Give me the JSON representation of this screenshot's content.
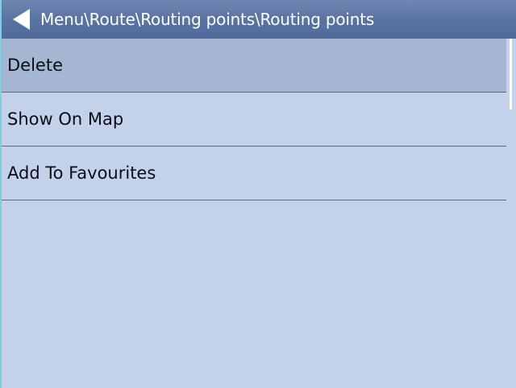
{
  "header": {
    "path": "Menu\\Route\\Routing points\\Routing points",
    "back_icon": "back-arrow-icon"
  },
  "menu": {
    "items": [
      {
        "label": "Delete",
        "selected": true
      },
      {
        "label": "Show On Map",
        "selected": false
      },
      {
        "label": "Add To Favourites",
        "selected": false
      }
    ]
  },
  "colors": {
    "titlebar": "#5b75a4",
    "background": "#c3d2ea",
    "selected": "#a5b6d3",
    "divider": "#5c6b80"
  }
}
